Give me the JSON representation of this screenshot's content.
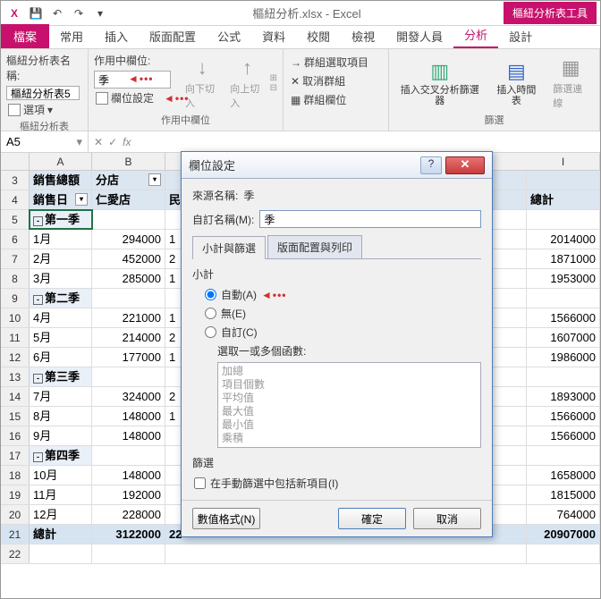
{
  "title": "樞紐分析.xlsx - Excel",
  "contextTab": "樞紐分析表工具",
  "tabs": {
    "file": "檔案",
    "home": "常用",
    "insert": "插入",
    "layout": "版面配置",
    "formula": "公式",
    "data": "資料",
    "review": "校閱",
    "view": "檢視",
    "dev": "開發人員",
    "analyze": "分析",
    "design": "設計"
  },
  "ribbon": {
    "pivotNameLabel": "樞紐分析表名稱:",
    "pivotName": "樞紐分析表5",
    "options": "選項",
    "activeFieldLabel": "作用中欄位:",
    "activeField": "季",
    "fieldSettings": "欄位設定",
    "drillDown": "向下切入",
    "drillUp": "向上切入",
    "groupSelect": "群組選取項目",
    "ungroup": "取消群組",
    "groupField": "群組欄位",
    "slicer1": "插入交叉分析篩選器",
    "timeline": "插入時間表",
    "filterConn": "篩選連線",
    "g1": "樞紐分析表",
    "g2": "作用中欄位",
    "g4": "篩選"
  },
  "namebox": "A5",
  "headers": {
    "A": "A",
    "B": "B",
    "I": "I"
  },
  "rows": [
    {
      "n": "3",
      "A": "銷售總額",
      "Afilter": true,
      "B": "分店",
      "Bfilter": true,
      "I": "",
      "hdr": true
    },
    {
      "n": "4",
      "A": "銷售日",
      "Afilter": true,
      "B": "仁愛店",
      "Bpart": "民",
      "I": "總計",
      "hdr": true
    },
    {
      "n": "5",
      "A": "第一季",
      "outline": "-",
      "sel": true,
      "B": "",
      "I": "",
      "sub": true
    },
    {
      "n": "6",
      "A": "1月",
      "B": "294000",
      "Bpart": "1",
      "I": "2014000"
    },
    {
      "n": "7",
      "A": "2月",
      "B": "452000",
      "Bpart": "2",
      "I": "1871000"
    },
    {
      "n": "8",
      "A": "3月",
      "B": "285000",
      "Bpart": "1",
      "I": "1953000"
    },
    {
      "n": "9",
      "A": "第二季",
      "outline": "-",
      "B": "",
      "I": "",
      "sub": true
    },
    {
      "n": "10",
      "A": "4月",
      "B": "221000",
      "Bpart": "1",
      "I": "1566000"
    },
    {
      "n": "11",
      "A": "5月",
      "B": "214000",
      "Bpart": "2",
      "I": "1607000"
    },
    {
      "n": "12",
      "A": "6月",
      "B": "177000",
      "Bpart": "1",
      "I": "1986000"
    },
    {
      "n": "13",
      "A": "第三季",
      "outline": "-",
      "B": "",
      "I": "",
      "sub": true
    },
    {
      "n": "14",
      "A": "7月",
      "B": "324000",
      "Bpart": "2",
      "I": "1893000"
    },
    {
      "n": "15",
      "A": "8月",
      "B": "148000",
      "Bpart": "1",
      "I": "1566000"
    },
    {
      "n": "16",
      "A": "9月",
      "B": "148000",
      "I": "1566000"
    },
    {
      "n": "17",
      "A": "第四季",
      "outline": "-",
      "B": "",
      "I": "",
      "sub": true
    },
    {
      "n": "18",
      "A": "10月",
      "B": "148000",
      "I": "1658000"
    },
    {
      "n": "19",
      "A": "11月",
      "B": "192000",
      "I": "1815000"
    },
    {
      "n": "20",
      "A": "12月",
      "B": "228000",
      "I": "764000"
    },
    {
      "n": "21",
      "A": "總計",
      "B": "3122000",
      "Bpart": "22",
      "I": "20907000",
      "total": true
    },
    {
      "n": "22",
      "A": "",
      "B": "",
      "I": ""
    }
  ],
  "dialog": {
    "title": "欄位設定",
    "sourceLabel": "來源名稱:",
    "sourceValue": "季",
    "customNameLabel": "自訂名稱(M):",
    "customName": "季",
    "tab1": "小計與篩選",
    "tab2": "版面配置與列印",
    "subtotalLabel": "小計",
    "auto": "自動(A)",
    "none": "無(E)",
    "custom": "自訂(C)",
    "selectFuncs": "選取一或多個函數:",
    "funcs": [
      "加總",
      "項目個數",
      "平均值",
      "最大值",
      "最小值",
      "乘積"
    ],
    "filterLabel": "篩選",
    "includeNew": "在手動篩選中包括新項目(I)",
    "numFormat": "數值格式(N)",
    "ok": "確定",
    "cancel": "取消"
  }
}
